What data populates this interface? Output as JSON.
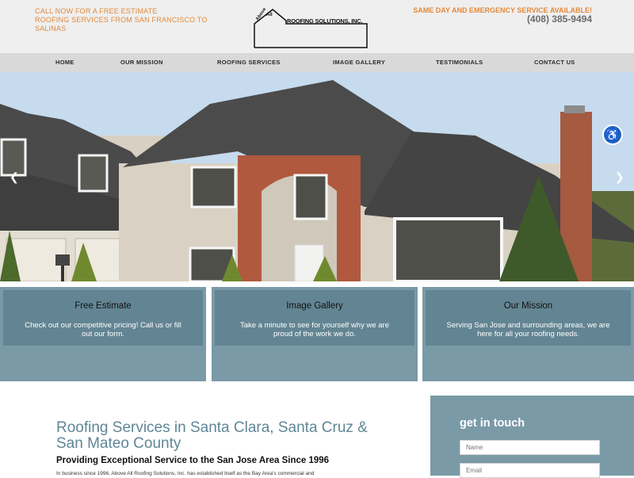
{
  "header": {
    "cta_line1": "CALL NOW FOR A FREE ESTIMATE",
    "cta_line2": "ROOFING SERVICES FROM SAN FRANCISCO TO SALINAS",
    "logo_above": "Above",
    "logo_all": "All",
    "logo_name": "ROOFING SOLUTIONS, INC.",
    "emergency": "SAME DAY AND EMERGENCY SERVICE AVAILABLE!",
    "phone": "(408) 385-9494"
  },
  "nav": {
    "items": [
      {
        "label": "HOME"
      },
      {
        "label": "OUR MISSION"
      },
      {
        "label": "ROOFING SERVICES"
      },
      {
        "label": "IMAGE GALLERY"
      },
      {
        "label": "TESTIMONIALS"
      },
      {
        "label": "CONTACT US"
      }
    ]
  },
  "hero": {
    "prev_icon": "chevron-left-icon",
    "next_icon": "chevron-right-icon",
    "accessibility_icon": "accessibility-icon"
  },
  "features": [
    {
      "title": "Free Estimate",
      "text": "Check out our competitive pricing! Call us or fill out our form."
    },
    {
      "title": "Image Gallery",
      "text": "Take a minute to see for yourself why we are proud of the work we do."
    },
    {
      "title": "Our Mission",
      "text": "Serving San Jose and surrounding areas, we are here for all your roofing needs."
    }
  ],
  "main": {
    "title": "Roofing Services in Santa Clara, Santa Cruz & San Mateo County",
    "subtitle": "Providing Exceptional Service to the San Jose Area Since 1996",
    "body": "In business since 1996, Above All Roofing Solutions, Inc. has established itself as the Bay Area's commercial and"
  },
  "contact": {
    "title": "get in touch",
    "name_placeholder": "Name",
    "email_placeholder": "Email"
  },
  "colors": {
    "accent_orange": "#e3893a",
    "panel_blue": "#7a9aa7",
    "title_blue": "#5f8696"
  }
}
